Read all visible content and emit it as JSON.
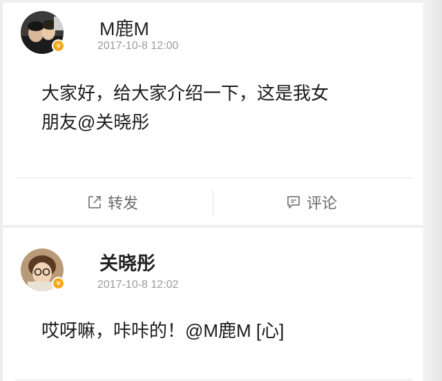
{
  "post": {
    "username": "M鹿M",
    "timestamp": "2017-10-8 12:00",
    "content_line1": "大家好，给大家介绍一下，这是我女",
    "content_line2": "朋友@关晓彤",
    "repost_label": "转发",
    "comment_label": "评论"
  },
  "reply": {
    "username": "关晓彤",
    "timestamp": "2017-10-8 12:02",
    "content": "哎呀嘛，咔咔的！@M鹿M [心]"
  },
  "colors": {
    "verified_badge": "#f5a623",
    "timestamp": "#9a9a9a",
    "action_text": "#6b6b6b"
  },
  "icons": {
    "repost": "share-arrow-box-icon",
    "comment": "speech-bubble-icon",
    "verified": "verified-badge-icon"
  }
}
